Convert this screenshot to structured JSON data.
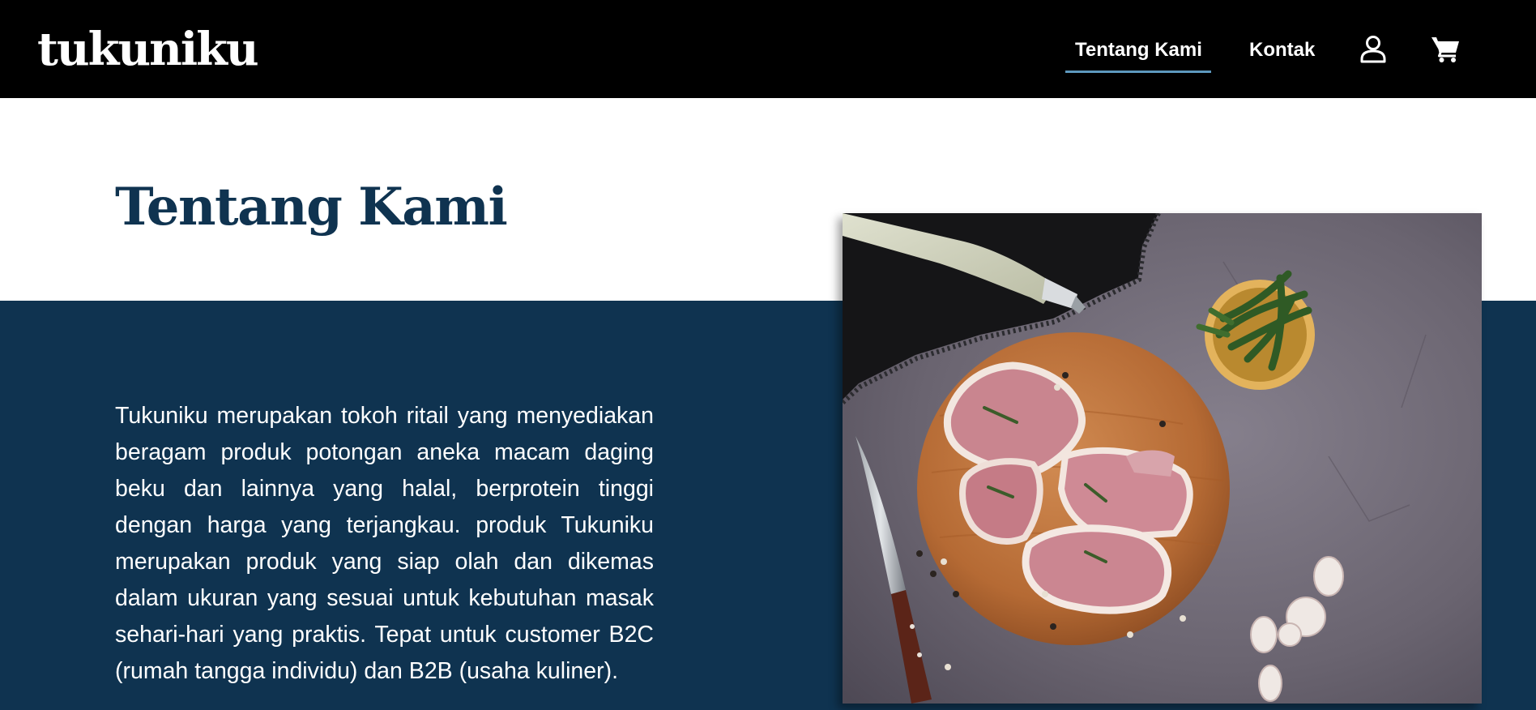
{
  "brand": {
    "logo_text": "tukuniku"
  },
  "nav": {
    "items": [
      {
        "label": "Tentang Kami",
        "active": true
      },
      {
        "label": "Kontak",
        "active": false
      }
    ],
    "icons": [
      "user-icon",
      "cart-icon"
    ]
  },
  "colors": {
    "header_bg": "#000000",
    "primary_navy": "#0f3350",
    "active_underline": "#5d98bd",
    "text_on_dark": "#ffffff"
  },
  "about": {
    "title": "Tentang Kami",
    "body": "Tukuniku merupakan tokoh ritail yang menyediakan beragam produk potongan aneka macam daging beku dan lainnya yang halal, berprotein tinggi dengan harga yang terjangkau. produk Tukuniku merupakan produk yang siap olah dan dikemas dalam ukuran yang sesuai untuk kebutuhan masak sehari-hari yang praktis. Tepat untuk customer B2C (rumah tangga individu) dan B2B (usaha kuliner)."
  }
}
